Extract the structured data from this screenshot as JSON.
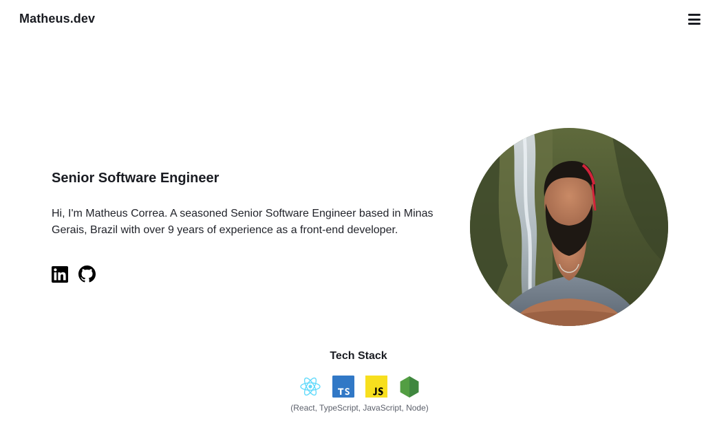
{
  "header": {
    "logo": "Matheus.dev",
    "menu_icon": "hamburger-menu-icon"
  },
  "hero": {
    "title": "Senior Software Engineer",
    "description": "Hi, I'm Matheus Correa. A seasoned Senior Software Engineer based in Minas Gerais, Brazil with over 9 years of experience as a front-end developer.",
    "socials": [
      {
        "icon": "linkedin-icon",
        "color": "#000000"
      },
      {
        "icon": "github-icon",
        "color": "#000000"
      }
    ],
    "avatar_icon": "profile-photo"
  },
  "tech_stack": {
    "title": "Tech Stack",
    "icons": [
      {
        "icon": "react-icon",
        "color": "#61dafb"
      },
      {
        "icon": "typescript-icon",
        "color": "#3178c6"
      },
      {
        "icon": "javascript-icon",
        "color": "#f7df1e"
      },
      {
        "icon": "nodejs-icon",
        "color": "#539e43"
      }
    ],
    "caption": "(React, TypeScript, JavaScript, Node)"
  }
}
